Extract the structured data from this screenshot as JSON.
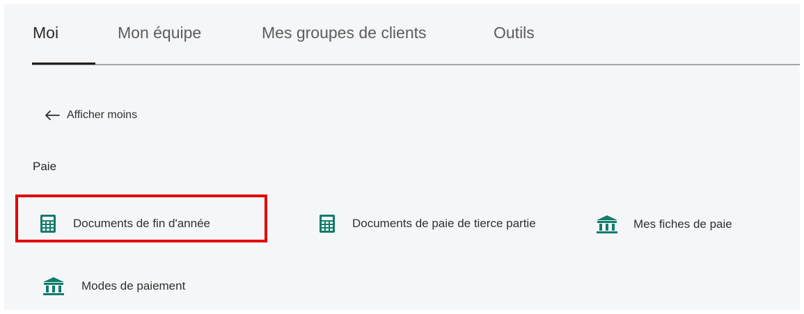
{
  "tabs": [
    {
      "label": "Moi",
      "active": true
    },
    {
      "label": "Mon équipe",
      "active": false
    },
    {
      "label": "Mes groupes de clients",
      "active": false
    },
    {
      "label": "Outils",
      "active": false
    }
  ],
  "back_link": {
    "label": "Afficher moins",
    "icon": "arrow-left-icon"
  },
  "section": {
    "title": "Paie"
  },
  "items": [
    {
      "label": "Documents de fin d'année",
      "icon": "calculator-icon",
      "highlighted": true
    },
    {
      "label": "Documents de paie de tierce partie",
      "icon": "calculator-icon",
      "highlighted": false
    },
    {
      "label": "Mes fiches de paie",
      "icon": "bank-icon",
      "highlighted": false
    },
    {
      "label": "Modes de paiement",
      "icon": "bank-icon",
      "highlighted": false
    }
  ],
  "colors": {
    "icon": "#0f7b6c",
    "highlight": "#e30000",
    "active_tab_underline": "#1f1f1f"
  }
}
